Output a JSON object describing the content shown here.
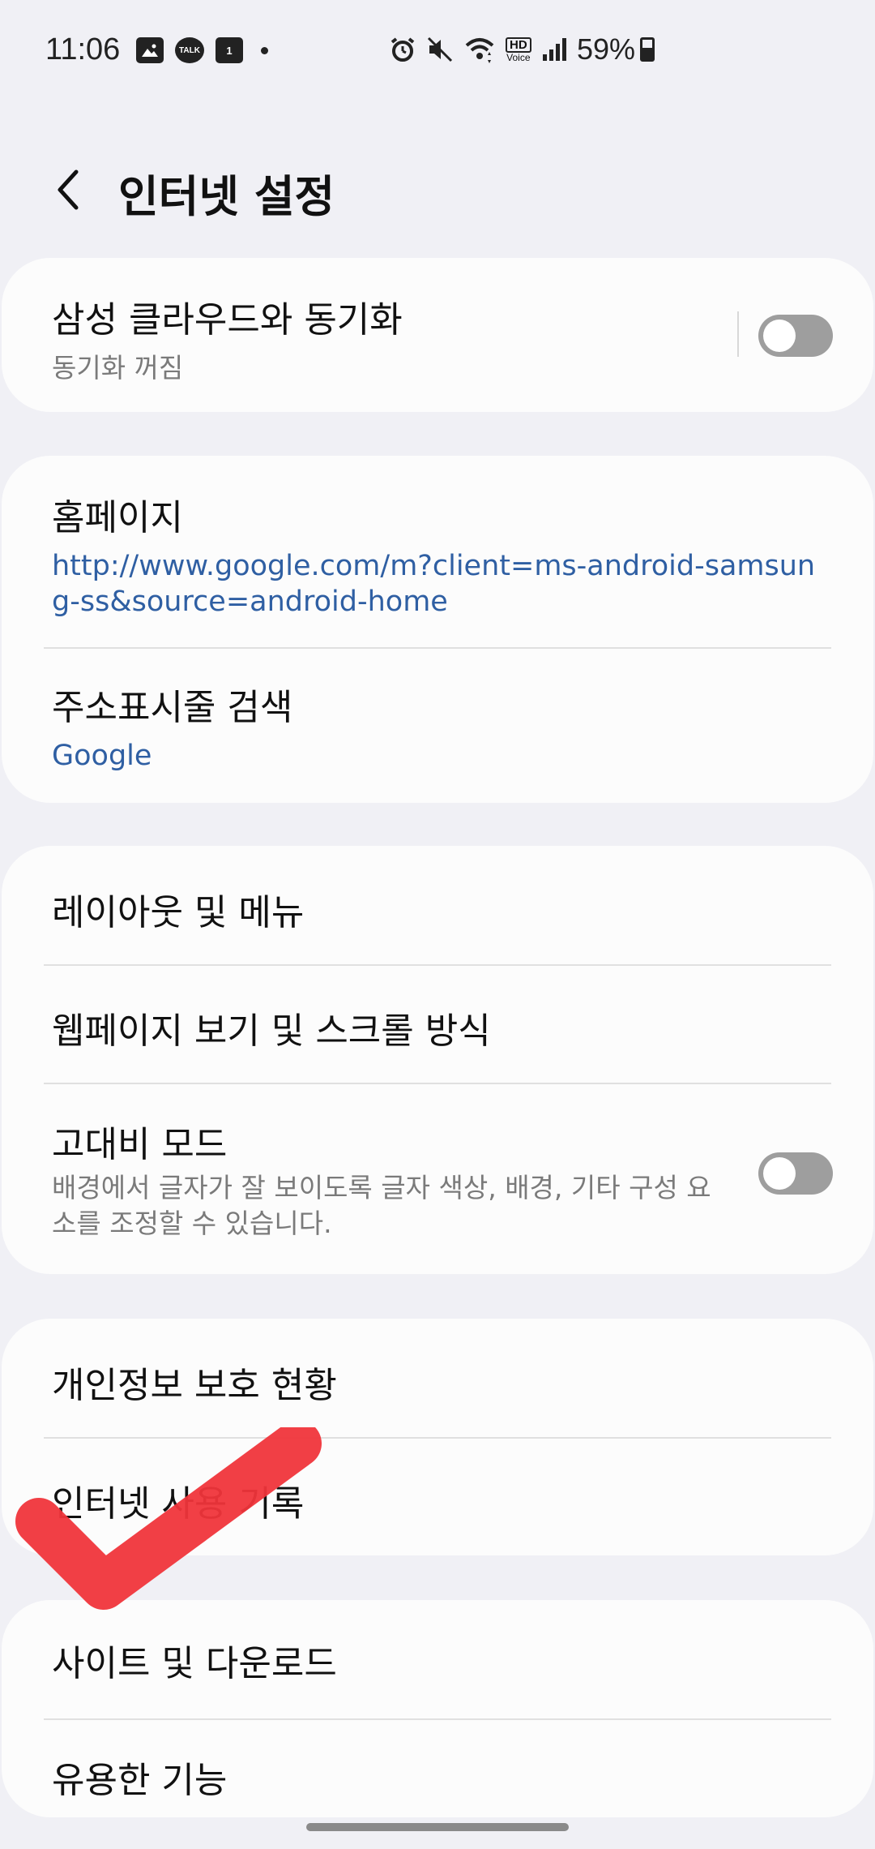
{
  "status_bar": {
    "time": "11:06",
    "battery": "59%",
    "hd_label": "HD",
    "voice_label": "Voice",
    "talk_label": "TALK",
    "calendar_day": "1"
  },
  "header": {
    "title": "인터넷 설정"
  },
  "cards": {
    "sync": {
      "title": "삼성 클라우드와 동기화",
      "subtitle": "동기화 꺼짐"
    },
    "homepage": {
      "title": "홈페이지",
      "value": "http://www.google.com/m?client=ms-android-samsung-ss&source=android-home"
    },
    "address_bar_search": {
      "title": "주소표시줄 검색",
      "value": "Google"
    },
    "layout_menu": {
      "title": "레이아웃 및 메뉴"
    },
    "webpage_view": {
      "title": "웹페이지 보기 및 스크롤 방식"
    },
    "high_contrast": {
      "title": "고대비 모드",
      "subtitle": "배경에서 글자가 잘 보이도록 글자 색상, 배경, 기타 구성 요소를 조정할 수 있습니다."
    },
    "privacy": {
      "title": "개인정보 보호 현황"
    },
    "internet_history": {
      "title": "인터넷 사용 기록"
    },
    "sites_downloads": {
      "title": "사이트 및 다운로드"
    },
    "useful_features": {
      "title": "유용한 기능"
    }
  },
  "colors": {
    "background": "#f0f0f5",
    "card": "#fcfcfc",
    "link": "#2f5fa3",
    "toggle_off": "#9e9e9e",
    "checkmark": "#f0353b"
  },
  "toggles": {
    "sync": false,
    "high_contrast": false
  }
}
